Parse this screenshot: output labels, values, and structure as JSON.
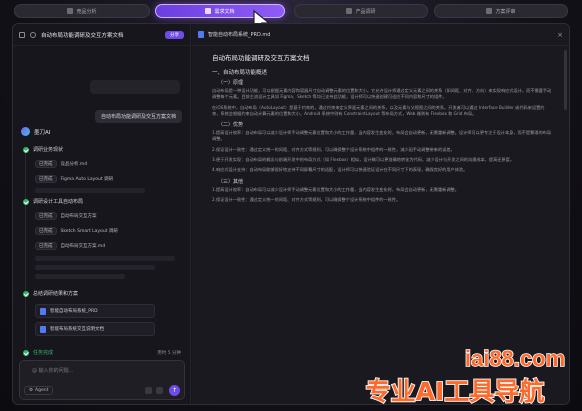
{
  "nav": {
    "items": [
      {
        "label": "竞品分析"
      },
      {
        "label": "需求文档"
      },
      {
        "label": "产品调研"
      },
      {
        "label": "方案评审"
      }
    ]
  },
  "left": {
    "title": "自动布局功能调研及交互方案文档",
    "share_label": "分享",
    "user_message": "自动布局功能调研及交互方案文档",
    "agent_name": "墨刀AI",
    "sections": [
      {
        "title": "调研业务现状",
        "tasks": [
          {
            "status": "已完成",
            "text": "竞品分析.md"
          },
          {
            "status": "已完成",
            "text": "Figma Auto Layout 调研"
          }
        ]
      },
      {
        "title": "调研设计工具自动布局",
        "tasks": [
          {
            "status": "已完成",
            "text": "自动布局交互方案"
          },
          {
            "status": "已完成",
            "text": "Sketch Smart Layout 调研"
          },
          {
            "status": "已完成",
            "text": "自动布局交互方案.md"
          }
        ]
      },
      {
        "title": "总结调研结果和方案",
        "files": [
          {
            "name": "智能自动布局系统_PRD"
          },
          {
            "name": "智能布局系统交互说明文档"
          }
        ]
      }
    ],
    "done_label": "任务完成",
    "done_time": "用时 5 分钟",
    "input_placeholder": "@ 输入你的问题...",
    "mode_label": "Agent"
  },
  "doc": {
    "filename": "智能自动布局系统_PRD.md",
    "title": "自动布局功能调研及交互方案文档",
    "section1": "一、自动布局功能概述",
    "sub1": "（一）原理",
    "p1": "自动布局是一种设计功能，可以根据元素内容和容器尺寸自动调整元素的位置和大小。它允许设计师通过定义元素之间的关系（如间距、对齐、方向）来实现响应式设计，而不需要手动调整每个元素。目前主流设计工具如 Figma、Sketch 等均已支持此功能，设计师可以快速创建可适应不同内容和尺寸的组件。",
    "p2": "在iOS系统中，自动布局（AutoLayout）是基于约束的，通过约束来定义界面元素之间的关系，以及元素与父视图之间的关系。开发者可以通过 Interface Builder 或代码来设置约束，系统会根据约束自动计算元素的位置和大小。Android 系统中则有 ConstraintLayout 等布局方式，Web 端则有 Flexbox 和 Grid 布局。",
    "sub2": "（二）优势",
    "p3": "1.提高设计效率：自动布局可以减少设计师手动调整元素位置和大小的工作量，当内容发生变化时，布局会自动更新，无需重新调整。设计师可以更专注于设计本身，而不是繁琐的布局调整。",
    "p4": "2.保证设计一致性：通过定义统一的间距、对齐方式等规则，可以确保整个设计系统中组件的一致性，减少因手动调整带来的误差。",
    "p5": "3.便于开发实现：自动布局的概念与前端开发中的布局方式（如 Flexbox）相似，设计稿可以更准确地转化为代码，减少设计与开发之间的沟通成本，提高还原度。",
    "p6": "4.响应式设计支持：自动布局能够很好地支持不同屏幕尺寸的适配，设计师可以快速验证设计在不同尺寸下的表现，确保良好的用户体验。",
    "sub3": "（三）其他",
    "p7": "1.提高设计效率：自动布局可以减少设计师手动调整元素位置和大小的工作量，当内容发生变化时，布局会自动更新，无需重新调整。",
    "p8": "2.保证设计一致性：通过定义统一的间距、对齐方式等规则，可以确保整个设计系统中组件的一致性。"
  },
  "watermark": {
    "line1": "iai88.com",
    "line2": "专业AI工具导航"
  },
  "colors": {
    "accent": "#6d4ce8",
    "success": "#2fb86a",
    "watermark": "#ff6a2a"
  }
}
